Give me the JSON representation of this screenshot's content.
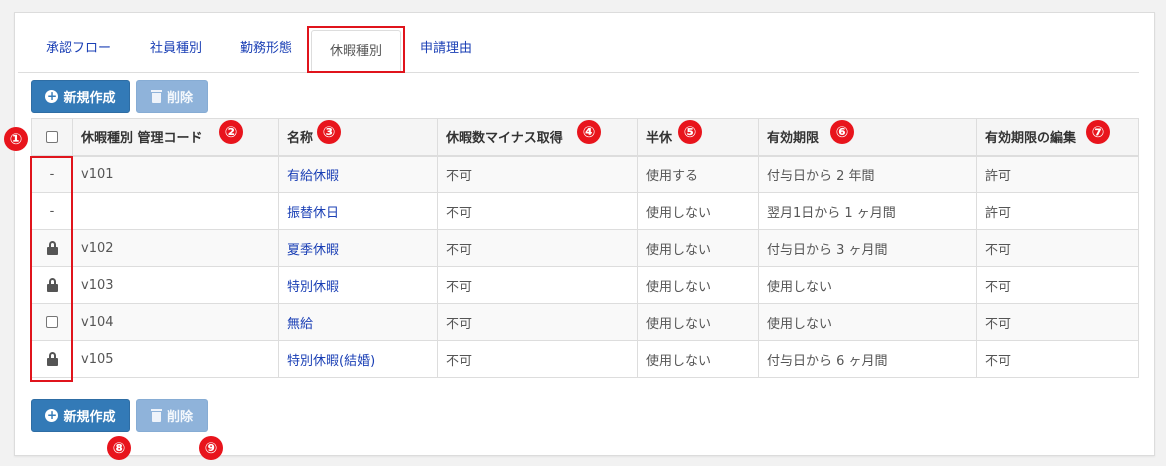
{
  "tabs": [
    {
      "label": "承認フロー",
      "active": false
    },
    {
      "label": "社員種別",
      "active": false
    },
    {
      "label": "勤務形態",
      "active": false
    },
    {
      "label": "休暇種別",
      "active": true
    },
    {
      "label": "申請理由",
      "active": false
    }
  ],
  "toolbar": {
    "new_label": "新規作成",
    "delete_label": "削除"
  },
  "table": {
    "headers": [
      "",
      "休暇種別 管理コード",
      "名称",
      "休暇数マイナス取得",
      "半休",
      "有効期限",
      "有効期限の編集"
    ],
    "rows": [
      {
        "select": "dash",
        "code": "v101",
        "name": "有給休暇",
        "minus": "不可",
        "half": "使用する",
        "expiry": "付与日から 2 年間",
        "edit": "許可"
      },
      {
        "select": "dash",
        "code": "",
        "name": "振替休日",
        "minus": "不可",
        "half": "使用しない",
        "expiry": "翌月1日から 1 ヶ月間",
        "edit": "許可"
      },
      {
        "select": "lock",
        "code": "v102",
        "name": "夏季休暇",
        "minus": "不可",
        "half": "使用しない",
        "expiry": "付与日から 3 ヶ月間",
        "edit": "不可"
      },
      {
        "select": "lock",
        "code": "v103",
        "name": "特別休暇",
        "minus": "不可",
        "half": "使用しない",
        "expiry": "使用しない",
        "edit": "不可"
      },
      {
        "select": "checkbox",
        "code": "v104",
        "name": "無給",
        "minus": "不可",
        "half": "使用しない",
        "expiry": "使用しない",
        "edit": "不可"
      },
      {
        "select": "lock",
        "code": "v105",
        "name": "特別休暇(結婚)",
        "minus": "不可",
        "half": "使用しない",
        "expiry": "付与日から 6 ヶ月間",
        "edit": "不可"
      }
    ]
  },
  "markers": {
    "m1": "①",
    "m2": "②",
    "m3": "③",
    "m4": "④",
    "m5": "⑤",
    "m6": "⑥",
    "m7": "⑦",
    "m8": "⑧",
    "m9": "⑨"
  },
  "dash_symbol": "-",
  "colors": {
    "primary": "#337ab7",
    "disabled": "#8fb3da",
    "link": "#1a3fb5",
    "highlight": "#e0141c"
  }
}
